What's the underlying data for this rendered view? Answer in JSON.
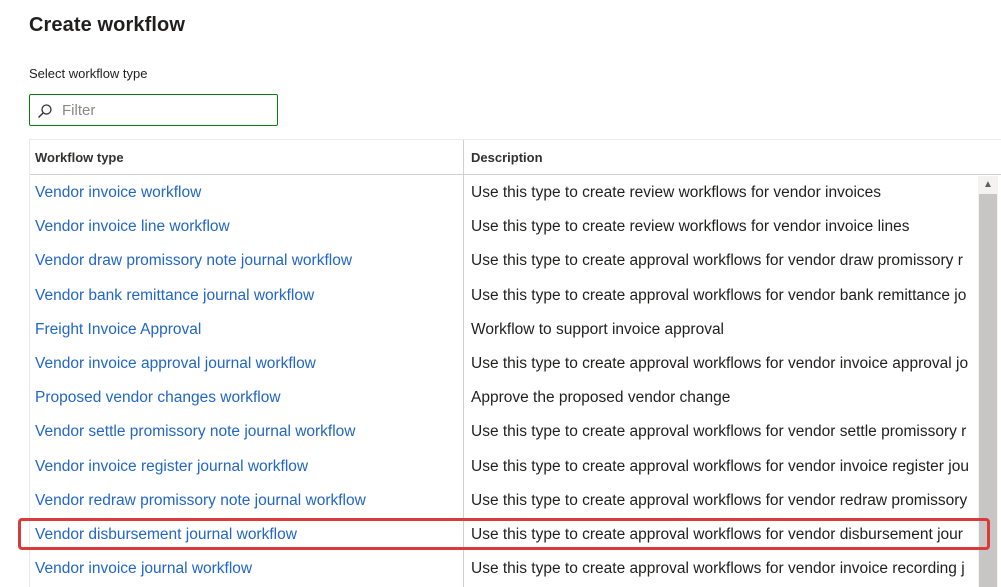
{
  "page": {
    "title": "Create workflow",
    "section_label": "Select workflow type"
  },
  "filter": {
    "placeholder": "Filter",
    "value": "",
    "icon": "search-icon"
  },
  "grid": {
    "columns": {
      "type": "Workflow type",
      "description": "Description"
    },
    "rows": [
      {
        "type": "Vendor invoice workflow",
        "description": "Use this type to create review workflows for vendor invoices"
      },
      {
        "type": "Vendor invoice line workflow",
        "description": "Use this type to create review workflows for vendor invoice lines"
      },
      {
        "type": "Vendor draw promissory note journal workflow",
        "description": "Use this type to create approval workflows for vendor draw promissory r"
      },
      {
        "type": "Vendor bank remittance journal workflow",
        "description": "Use this type to create approval workflows for vendor bank remittance jo"
      },
      {
        "type": "Freight Invoice Approval",
        "description": "Workflow to support invoice approval"
      },
      {
        "type": "Vendor invoice approval journal workflow",
        "description": "Use this type to create approval workflows for vendor invoice approval jo"
      },
      {
        "type": "Proposed vendor changes workflow",
        "description": "Approve the proposed vendor change"
      },
      {
        "type": "Vendor settle promissory note journal workflow",
        "description": "Use this type to create approval workflows for vendor settle promissory r"
      },
      {
        "type": "Vendor invoice register journal workflow",
        "description": "Use this type to create approval workflows for vendor invoice register jou"
      },
      {
        "type": "Vendor redraw promissory note journal workflow",
        "description": "Use this type to create approval workflows for vendor redraw promissory"
      },
      {
        "type": "Vendor disbursement journal workflow",
        "description": "Use this type to create approval workflows for vendor disbursement jour"
      },
      {
        "type": "Vendor invoice journal workflow",
        "description": "Use this type to create approval workflows for vendor invoice recording j"
      }
    ],
    "highlighted_row": "Vendor disbursement journal workflow"
  },
  "colors": {
    "link": "#2266c7",
    "focus_border": "#107c10",
    "highlight": "#d93b3b"
  }
}
